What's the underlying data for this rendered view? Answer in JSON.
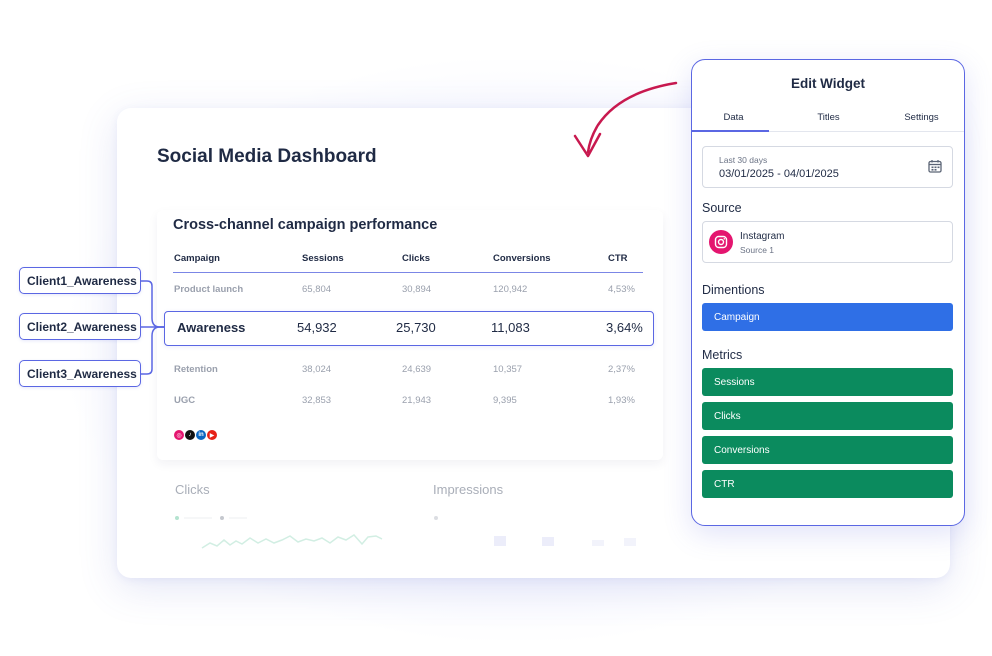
{
  "colors": {
    "accent": "#5b67e3",
    "dimension_blue": "#2f6fe6",
    "metric_green": "#0b8b5e",
    "arrow": "#c8194f"
  },
  "dashboard": {
    "title": "Social Media Dashboard",
    "widget": {
      "title": "Cross-channel campaign performance",
      "columns": [
        "Campaign",
        "Sessions",
        "Clicks",
        "Conversions",
        "CTR"
      ],
      "rows": [
        {
          "campaign": "Product launch",
          "sessions": "65,804",
          "clicks": "30,894",
          "conversions": "120,942",
          "ctr": "4,53%"
        },
        {
          "campaign": "Retention",
          "sessions": "38,024",
          "clicks": "24,639",
          "conversions": "10,357",
          "ctr": "2,37%"
        },
        {
          "campaign": "UGC",
          "sessions": "32,853",
          "clicks": "21,943",
          "conversions": "9,395",
          "ctr": "1,93%"
        }
      ],
      "highlighted_row": {
        "campaign": "Awareness",
        "sessions": "54,932",
        "clicks": "25,730",
        "conversions": "11,083",
        "ctr": "3,64%"
      },
      "social_icons": [
        "instagram-icon",
        "tiktok-icon",
        "linkedin-icon",
        "youtube-icon"
      ]
    },
    "faded_widgets": [
      "Clicks",
      "Impressions"
    ]
  },
  "client_tags": [
    "Client1_Awareness",
    "Client2_Awareness",
    "Client3_Awareness"
  ],
  "edit_widget": {
    "title": "Edit Widget",
    "tabs": [
      "Data",
      "Titles",
      "Settings"
    ],
    "active_tab": "Data",
    "date": {
      "label": "Last 30 days",
      "range": "03/01/2025 - 04/01/2025"
    },
    "source": {
      "heading": "Source",
      "name": "Instagram",
      "sub": "Source 1"
    },
    "dimensions": {
      "heading": "Dimentions",
      "items": [
        "Campaign"
      ]
    },
    "metrics": {
      "heading": "Metrics",
      "items": [
        "Sessions",
        "Clicks",
        "Conversions",
        "CTR"
      ]
    }
  }
}
